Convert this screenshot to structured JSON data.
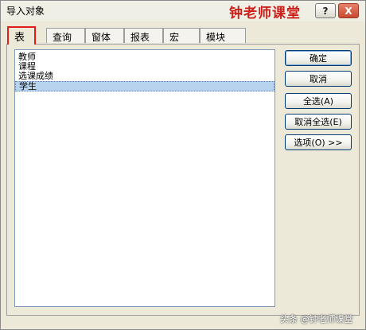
{
  "window": {
    "title": "导入对象",
    "help_label": "?",
    "close_label": "X"
  },
  "watermark": {
    "top": "钟老师课堂",
    "bottom": "头条 @钟老师课堂"
  },
  "tabs": [
    {
      "label": "表",
      "active": true
    },
    {
      "label": "查询"
    },
    {
      "label": "窗体"
    },
    {
      "label": "报表"
    },
    {
      "label": "宏"
    },
    {
      "label": "模块"
    }
  ],
  "list": {
    "items": [
      {
        "label": "教师"
      },
      {
        "label": "课程"
      },
      {
        "label": "选课成绩"
      },
      {
        "label": "学生",
        "selected": true
      }
    ]
  },
  "buttons": {
    "ok": "确定",
    "cancel": "取消",
    "select_all": "全选(A)",
    "deselect_all": "取消全选(E)",
    "options": "选项(O) >>"
  },
  "colors": {
    "dialog_bg": "#ece9d8",
    "active_tab_highlight": "#e21b1b",
    "selection_bg": "#b8d3ee",
    "close_button": "#c74a30"
  }
}
